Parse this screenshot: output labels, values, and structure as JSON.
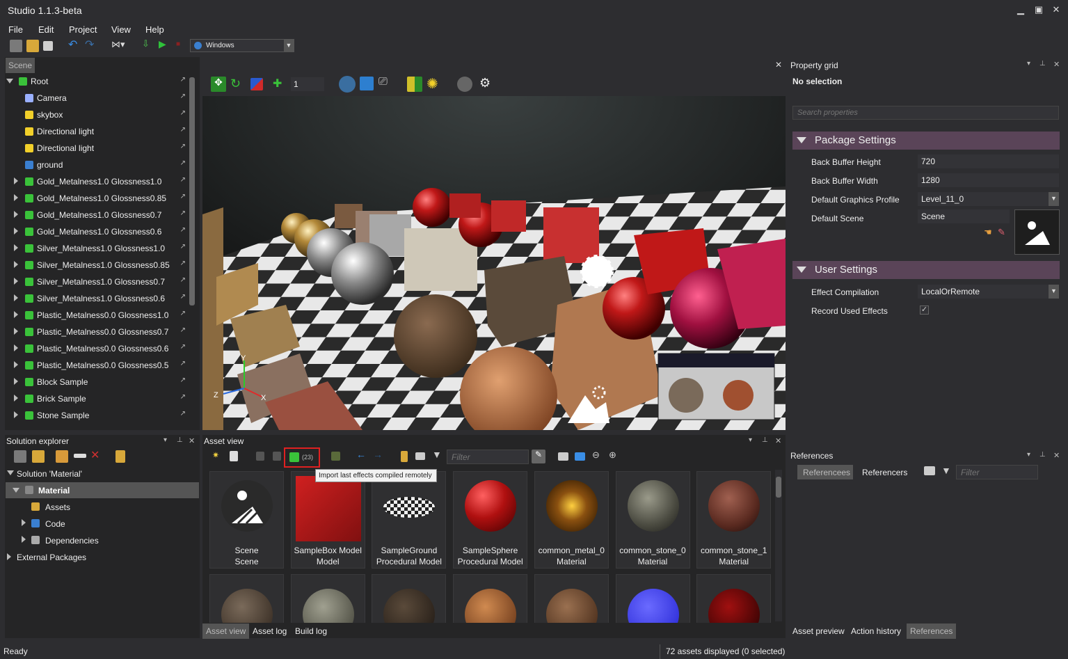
{
  "app": {
    "title": "Studio 1.1.3-beta"
  },
  "menu": [
    "File",
    "Edit",
    "Project",
    "View",
    "Help"
  ],
  "toolbar": {
    "platform": "Windows"
  },
  "scene_panel": {
    "tab": "Scene",
    "items": [
      {
        "label": "Root",
        "icon": "entity-icon"
      },
      {
        "label": "Camera",
        "icon": "camera-icon"
      },
      {
        "label": "skybox",
        "icon": "light-bulb-icon"
      },
      {
        "label": "Directional light",
        "icon": "light-bulb-icon"
      },
      {
        "label": "Directional light",
        "icon": "light-bulb-icon"
      },
      {
        "label": "ground",
        "icon": "model-icon"
      },
      {
        "label": "Gold_Metalness1.0 Glossness1.0",
        "icon": "entity-icon"
      },
      {
        "label": "Gold_Metalness1.0 Glossness0.85",
        "icon": "entity-icon"
      },
      {
        "label": "Gold_Metalness1.0 Glossness0.7",
        "icon": "entity-icon"
      },
      {
        "label": "Gold_Metalness1.0 Glossness0.6",
        "icon": "entity-icon"
      },
      {
        "label": "Silver_Metalness1.0 Glossness1.0",
        "icon": "entity-icon"
      },
      {
        "label": "Silver_Metalness1.0 Glossness0.85",
        "icon": "entity-icon"
      },
      {
        "label": "Silver_Metalness1.0 Glossness0.7",
        "icon": "entity-icon"
      },
      {
        "label": "Silver_Metalness1.0 Glossness0.6",
        "icon": "entity-icon"
      },
      {
        "label": "Plastic_Metalness0.0 Glossness1.0",
        "icon": "entity-icon"
      },
      {
        "label": "Plastic_Metalness0.0 Glossness0.7",
        "icon": "entity-icon"
      },
      {
        "label": "Plastic_Metalness0.0 Glossness0.6",
        "icon": "entity-icon"
      },
      {
        "label": "Plastic_Metalness0.0 Glossness0.5",
        "icon": "entity-icon"
      },
      {
        "label": "Block Sample",
        "icon": "entity-icon"
      },
      {
        "label": "Brick Sample",
        "icon": "entity-icon"
      },
      {
        "label": "Stone Sample",
        "icon": "entity-icon"
      }
    ]
  },
  "viewport": {
    "snap_value": "1",
    "axis_x": "X",
    "axis_y": "Y",
    "axis_z": "Z"
  },
  "property_grid": {
    "title": "Property grid",
    "selection": "No selection",
    "search_placeholder": "Search properties",
    "package_header": "Package Settings",
    "back_buffer_height_label": "Back Buffer Height",
    "back_buffer_height": "720",
    "back_buffer_width_label": "Back Buffer Width",
    "back_buffer_width": "1280",
    "graphics_profile_label": "Default Graphics Profile",
    "graphics_profile": "Level_11_0",
    "default_scene_label": "Default Scene",
    "default_scene": "Scene",
    "user_header": "User Settings",
    "effect_compilation_label": "Effect Compilation",
    "effect_compilation": "LocalOrRemote",
    "record_effects_label": "Record Used Effects",
    "record_effects_check": "✓"
  },
  "solution_explorer": {
    "title": "Solution explorer",
    "solution": "Solution 'Material'",
    "project": "Material",
    "assets": "Assets",
    "code": "Code",
    "dependencies": "Dependencies",
    "external": "External Packages"
  },
  "asset_view": {
    "title": "Asset view",
    "effects_count": "(23)",
    "filter_placeholder": "Filter",
    "tooltip": "Import last effects compiled remotely",
    "assets": [
      {
        "name": "Scene",
        "type": "Scene",
        "thumb": "scene"
      },
      {
        "name": "SampleBox Model",
        "type": "Model",
        "thumb": "box"
      },
      {
        "name": "SampleGround",
        "type": "Procedural Model",
        "thumb": "ground"
      },
      {
        "name": "SampleSphere",
        "type": "Procedural Model",
        "thumb": "red-sphere"
      },
      {
        "name": "common_metal_0",
        "type": "Material",
        "thumb": "metal"
      },
      {
        "name": "common_stone_0",
        "type": "Material",
        "thumb": "stone"
      },
      {
        "name": "common_stone_1",
        "type": "Material",
        "thumb": "brick"
      }
    ],
    "tabs": [
      "Asset view",
      "Asset log",
      "Build log"
    ]
  },
  "references": {
    "title": "References",
    "tab_references": "Referencees",
    "tab_referencers": "Referencers",
    "filter_placeholder": "Filter",
    "bottom_tabs": [
      "Asset preview",
      "Action history",
      "References"
    ]
  },
  "status": {
    "left": "Ready",
    "right": "72 assets displayed (0 selected)"
  },
  "colors": {
    "accent": "#5a4458",
    "tooltip_highlight": "#e02020",
    "background": "#2d2d30"
  }
}
